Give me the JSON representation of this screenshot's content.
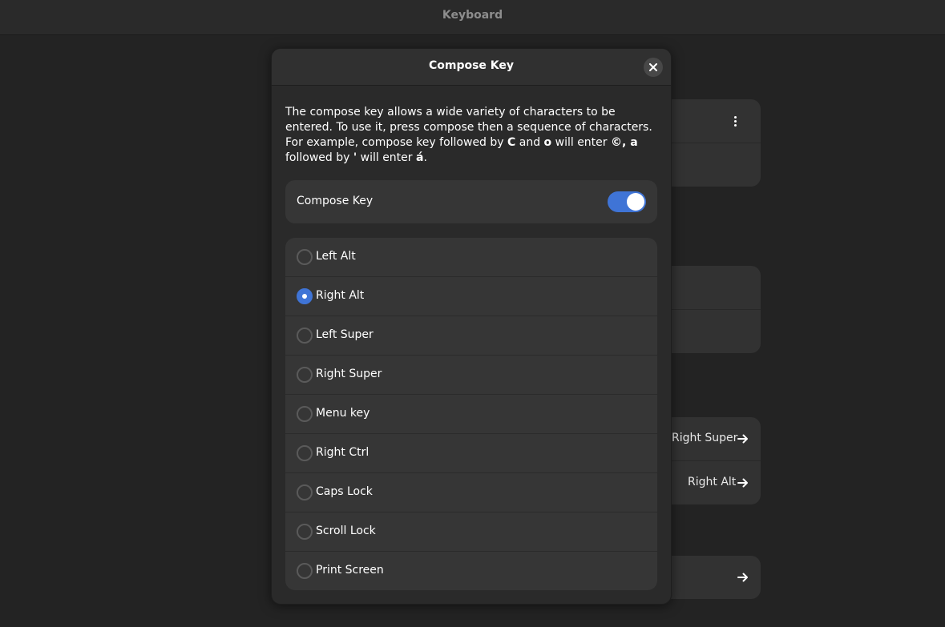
{
  "window": {
    "title": "Keyboard"
  },
  "background": {
    "row_right_super": "Right Super",
    "row_right_alt": "Right Alt"
  },
  "dialog": {
    "title": "Compose Key",
    "description_parts": {
      "p1": "The compose key allows a wide variety of characters to be entered. To use it, press compose then a sequence of characters.  For example, compose key followed by ",
      "k1": "C",
      "p2": " and ",
      "k2": "o",
      "p3": " will enter ",
      "k3": "©, a",
      "p4": " followed by ",
      "k4": "'",
      "p5": " will enter ",
      "k5": "á",
      "p6": "."
    },
    "toggle": {
      "label": "Compose Key",
      "state": "on"
    },
    "options": [
      {
        "label": "Left Alt",
        "checked": false
      },
      {
        "label": "Right Alt",
        "checked": true
      },
      {
        "label": "Left Super",
        "checked": false
      },
      {
        "label": "Right Super",
        "checked": false
      },
      {
        "label": "Menu key",
        "checked": false
      },
      {
        "label": "Right Ctrl",
        "checked": false
      },
      {
        "label": "Caps Lock",
        "checked": false
      },
      {
        "label": "Scroll Lock",
        "checked": false
      },
      {
        "label": "Print Screen",
        "checked": false
      }
    ]
  },
  "colors": {
    "accent": "#3f74d6",
    "window_bg": "#232323",
    "card_bg": "#363636"
  }
}
